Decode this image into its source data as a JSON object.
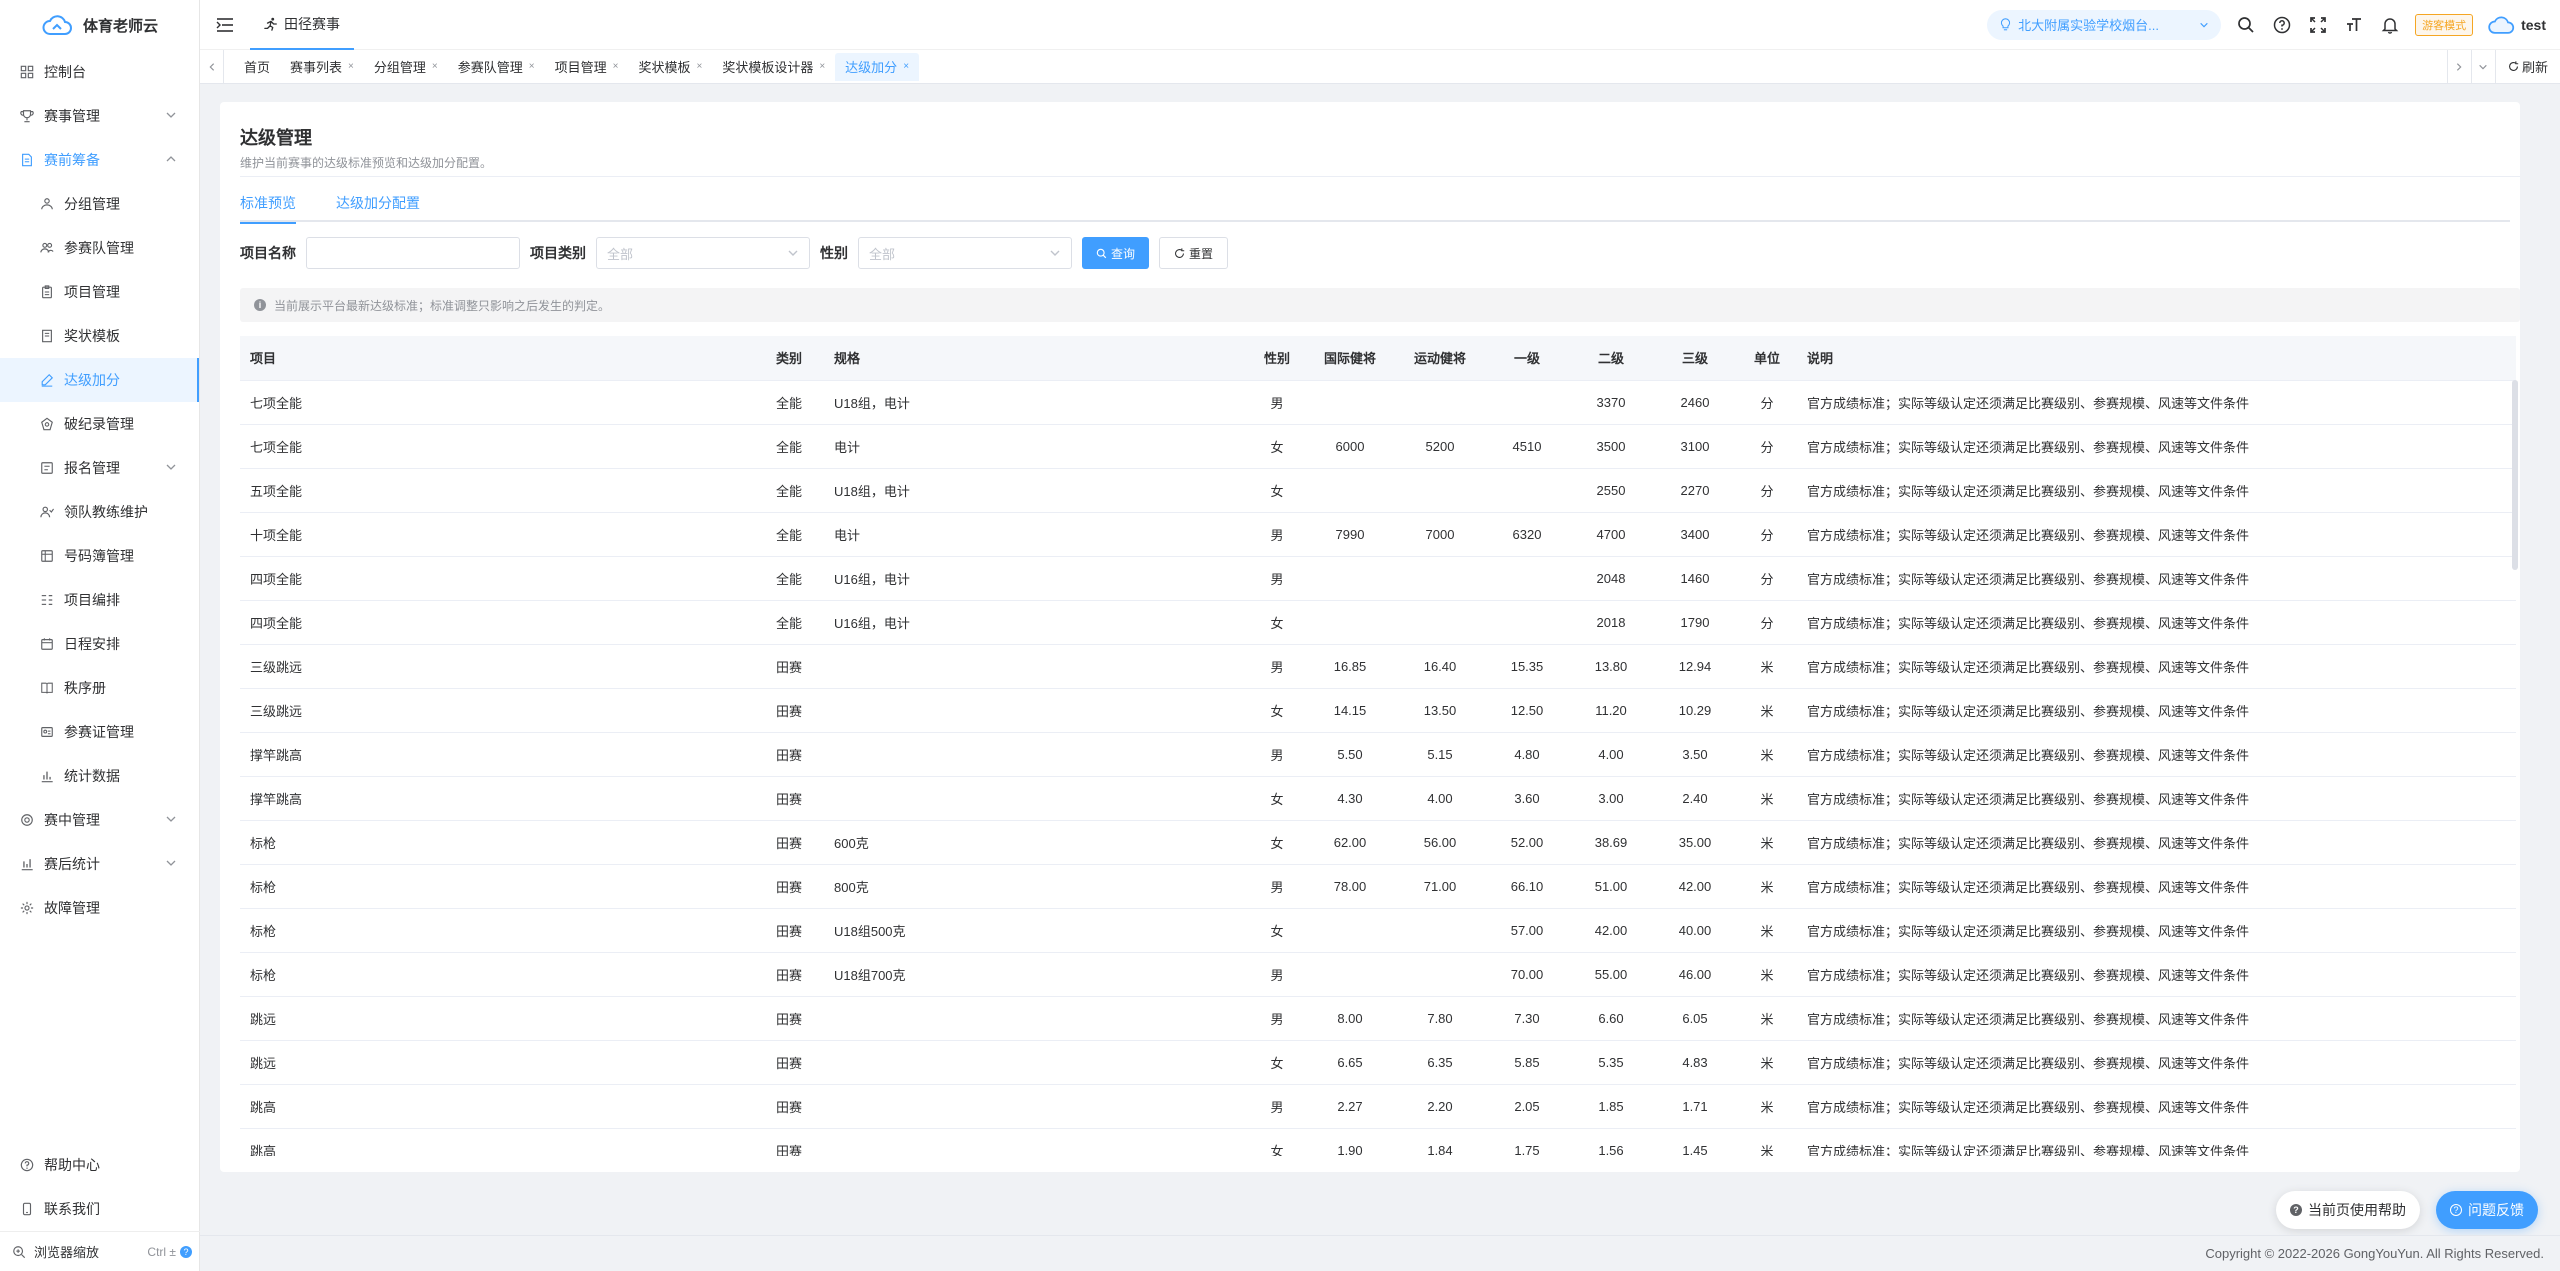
{
  "app": {
    "name": "体育老师云",
    "tab": "田径赛事"
  },
  "sidebar": {
    "items": [
      {
        "label": "控制台",
        "icon": "dashboard-icon",
        "level": 1
      },
      {
        "label": "赛事管理",
        "icon": "trophy-icon",
        "level": 1,
        "expandable": true
      },
      {
        "label": "赛前筹备",
        "icon": "document-icon",
        "level": 1,
        "expandable": true,
        "open": true
      },
      {
        "label": "分组管理",
        "icon": "users-group-icon",
        "level": 2
      },
      {
        "label": "参赛队管理",
        "icon": "team-icon",
        "level": 2
      },
      {
        "label": "项目管理",
        "icon": "clipboard-icon",
        "level": 2
      },
      {
        "label": "奖状模板",
        "icon": "certificate-icon",
        "level": 2
      },
      {
        "label": "达级加分",
        "icon": "edit-icon",
        "level": 2,
        "active": true
      },
      {
        "label": "破纪录管理",
        "icon": "record-icon",
        "level": 2
      },
      {
        "label": "报名管理",
        "icon": "form-icon",
        "level": 2,
        "expandable": true
      },
      {
        "label": "领队教练维护",
        "icon": "coach-icon",
        "level": 2
      },
      {
        "label": "号码簿管理",
        "icon": "number-book-icon",
        "level": 2
      },
      {
        "label": "项目编排",
        "icon": "schedule-list-icon",
        "level": 2
      },
      {
        "label": "日程安排",
        "icon": "calendar-icon",
        "level": 2
      },
      {
        "label": "秩序册",
        "icon": "book-icon",
        "level": 2
      },
      {
        "label": "参赛证管理",
        "icon": "badge-icon",
        "level": 2
      },
      {
        "label": "统计数据",
        "icon": "stats-icon",
        "level": 2
      },
      {
        "label": "赛中管理",
        "icon": "target-icon",
        "level": 1,
        "expandable": true
      },
      {
        "label": "赛后统计",
        "icon": "bar-chart-icon",
        "level": 1,
        "expandable": true
      },
      {
        "label": "故障管理",
        "icon": "gear-icon",
        "level": 1
      }
    ],
    "bottom": {
      "help": "帮助中心",
      "contact": "联系我们",
      "zoom": "浏览器缩放",
      "zoom_shortcut": "Ctrl ±"
    }
  },
  "header": {
    "school": "北大附属实验学校烟台...",
    "mode": "游客模式",
    "user": "test"
  },
  "tags": [
    {
      "label": "首页",
      "closable": false
    },
    {
      "label": "赛事列表",
      "closable": true
    },
    {
      "label": "分组管理",
      "closable": true
    },
    {
      "label": "参赛队管理",
      "closable": true
    },
    {
      "label": "项目管理",
      "closable": true
    },
    {
      "label": "奖状模板",
      "closable": true
    },
    {
      "label": "奖状模板设计器",
      "closable": true
    },
    {
      "label": "达级加分",
      "closable": true,
      "active": true
    }
  ],
  "tags_refresh": "刷新",
  "page": {
    "title": "达级管理",
    "subtitle": "维护当前赛事的达级标准预览和达级加分配置。",
    "tabs": [
      "标准预览",
      "达级加分配置"
    ],
    "filters": {
      "name_label": "项目名称",
      "name_value": "",
      "category_label": "项目类别",
      "category_placeholder": "全部",
      "gender_label": "性别",
      "gender_placeholder": "全部",
      "search": "查询",
      "reset": "重置"
    },
    "notice": "当前展示平台最新达级标准；标准调整只影响之后发生的判定。"
  },
  "table": {
    "columns": [
      "项目",
      "类别",
      "规格",
      "性别",
      "国际健将",
      "运动健将",
      "一级",
      "二级",
      "三级",
      "单位",
      "说明"
    ],
    "rows": [
      [
        "七项全能",
        "全能",
        "U18组，电计",
        "男",
        "",
        "",
        "",
        "3370",
        "2460",
        "分",
        "官方成绩标准；实际等级认定还须满足比赛级别、参赛规模、风速等文件条件"
      ],
      [
        "七项全能",
        "全能",
        "电计",
        "女",
        "6000",
        "5200",
        "4510",
        "3500",
        "3100",
        "分",
        "官方成绩标准；实际等级认定还须满足比赛级别、参赛规模、风速等文件条件"
      ],
      [
        "五项全能",
        "全能",
        "U18组，电计",
        "女",
        "",
        "",
        "",
        "2550",
        "2270",
        "分",
        "官方成绩标准；实际等级认定还须满足比赛级别、参赛规模、风速等文件条件"
      ],
      [
        "十项全能",
        "全能",
        "电计",
        "男",
        "7990",
        "7000",
        "6320",
        "4700",
        "3400",
        "分",
        "官方成绩标准；实际等级认定还须满足比赛级别、参赛规模、风速等文件条件"
      ],
      [
        "四项全能",
        "全能",
        "U16组，电计",
        "男",
        "",
        "",
        "",
        "2048",
        "1460",
        "分",
        "官方成绩标准；实际等级认定还须满足比赛级别、参赛规模、风速等文件条件"
      ],
      [
        "四项全能",
        "全能",
        "U16组，电计",
        "女",
        "",
        "",
        "",
        "2018",
        "1790",
        "分",
        "官方成绩标准；实际等级认定还须满足比赛级别、参赛规模、风速等文件条件"
      ],
      [
        "三级跳远",
        "田赛",
        "",
        "男",
        "16.85",
        "16.40",
        "15.35",
        "13.80",
        "12.94",
        "米",
        "官方成绩标准；实际等级认定还须满足比赛级别、参赛规模、风速等文件条件"
      ],
      [
        "三级跳远",
        "田赛",
        "",
        "女",
        "14.15",
        "13.50",
        "12.50",
        "11.20",
        "10.29",
        "米",
        "官方成绩标准；实际等级认定还须满足比赛级别、参赛规模、风速等文件条件"
      ],
      [
        "撑竿跳高",
        "田赛",
        "",
        "男",
        "5.50",
        "5.15",
        "4.80",
        "4.00",
        "3.50",
        "米",
        "官方成绩标准；实际等级认定还须满足比赛级别、参赛规模、风速等文件条件"
      ],
      [
        "撑竿跳高",
        "田赛",
        "",
        "女",
        "4.30",
        "4.00",
        "3.60",
        "3.00",
        "2.40",
        "米",
        "官方成绩标准；实际等级认定还须满足比赛级别、参赛规模、风速等文件条件"
      ],
      [
        "标枪",
        "田赛",
        "600克",
        "女",
        "62.00",
        "56.00",
        "52.00",
        "38.69",
        "35.00",
        "米",
        "官方成绩标准；实际等级认定还须满足比赛级别、参赛规模、风速等文件条件"
      ],
      [
        "标枪",
        "田赛",
        "800克",
        "男",
        "78.00",
        "71.00",
        "66.10",
        "51.00",
        "42.00",
        "米",
        "官方成绩标准；实际等级认定还须满足比赛级别、参赛规模、风速等文件条件"
      ],
      [
        "标枪",
        "田赛",
        "U18组500克",
        "女",
        "",
        "",
        "57.00",
        "42.00",
        "40.00",
        "米",
        "官方成绩标准；实际等级认定还须满足比赛级别、参赛规模、风速等文件条件"
      ],
      [
        "标枪",
        "田赛",
        "U18组700克",
        "男",
        "",
        "",
        "70.00",
        "55.00",
        "46.00",
        "米",
        "官方成绩标准；实际等级认定还须满足比赛级别、参赛规模、风速等文件条件"
      ],
      [
        "跳远",
        "田赛",
        "",
        "男",
        "8.00",
        "7.80",
        "7.30",
        "6.60",
        "6.05",
        "米",
        "官方成绩标准；实际等级认定还须满足比赛级别、参赛规模、风速等文件条件"
      ],
      [
        "跳远",
        "田赛",
        "",
        "女",
        "6.65",
        "6.35",
        "5.85",
        "5.35",
        "4.83",
        "米",
        "官方成绩标准；实际等级认定还须满足比赛级别、参赛规模、风速等文件条件"
      ],
      [
        "跳高",
        "田赛",
        "",
        "男",
        "2.27",
        "2.20",
        "2.05",
        "1.85",
        "1.71",
        "米",
        "官方成绩标准；实际等级认定还须满足比赛级别、参赛规模、风速等文件条件"
      ],
      [
        "跳高",
        "田赛",
        "",
        "女",
        "1.90",
        "1.84",
        "1.75",
        "1.56",
        "1.45",
        "米",
        "官方成绩标准；实际等级认定还须满足比赛级别、参赛规模、风速等文件条件"
      ]
    ]
  },
  "footer": {
    "copyright": "Copyright © 2022-2026 GongYouYun. All Rights Reserved."
  },
  "floating": {
    "help": "当前页使用帮助",
    "feedback": "问题反馈"
  },
  "colors": {
    "primary": "#409eff",
    "warning": "#f5a623",
    "text": "#303133",
    "muted": "#909399"
  }
}
